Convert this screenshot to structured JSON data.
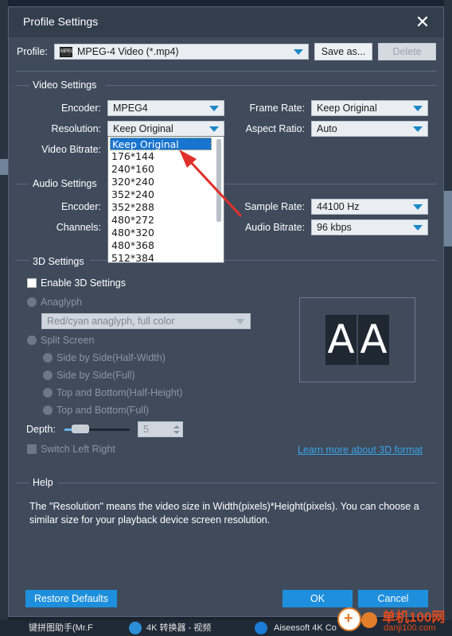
{
  "window": {
    "title": "Profile Settings",
    "close_glyph": "✕"
  },
  "profile": {
    "label": "Profile:",
    "value": "MPEG-4 Video (*.mp4)",
    "icon_text": "MPEG4",
    "save_as_label": "Save as...",
    "delete_label": "Delete"
  },
  "video": {
    "section_title": "Video Settings",
    "encoder_label": "Encoder:",
    "encoder_value": "MPEG4",
    "frame_rate_label": "Frame Rate:",
    "frame_rate_value": "Keep Original",
    "resolution_label": "Resolution:",
    "resolution_value": "Keep Original",
    "aspect_ratio_label": "Aspect Ratio:",
    "aspect_ratio_value": "Auto",
    "bitrate_label": "Video Bitrate:"
  },
  "resolution_dropdown": {
    "options": [
      "Keep Original",
      "176*144",
      "240*160",
      "320*240",
      "352*240",
      "352*288",
      "480*272",
      "480*320",
      "480*368",
      "512*384"
    ],
    "selected_index": 0
  },
  "audio": {
    "section_title": "Audio Settings",
    "encoder_label": "Encoder:",
    "sample_rate_label": "Sample Rate:",
    "sample_rate_value": "44100 Hz",
    "channels_label": "Channels:",
    "audio_bitrate_label": "Audio Bitrate:",
    "audio_bitrate_value": "96 kbps"
  },
  "three_d": {
    "section_title": "3D Settings",
    "enable_label": "Enable 3D Settings",
    "anaglyph_label": "Anaglyph",
    "anaglyph_value": "Red/cyan anaglyph, full color",
    "split_screen_label": "Split Screen",
    "sbs_half_label": "Side by Side(Half-Width)",
    "sbs_full_label": "Side by Side(Full)",
    "tb_half_label": "Top and Bottom(Half-Height)",
    "tb_full_label": "Top and Bottom(Full)",
    "depth_label": "Depth:",
    "depth_value": "5",
    "depth_level": 0.15,
    "switch_label": "Switch Left Right",
    "learn_more_label": "Learn more about 3D format",
    "preview_letter_left": "A",
    "preview_letter_right": "A"
  },
  "help": {
    "section_title": "Help",
    "text": "The \"Resolution\" means the video size in Width(pixels)*Height(pixels).  You can choose a similar size for your playback device screen resolution."
  },
  "footer": {
    "restore_label": "Restore Defaults",
    "ok_label": "OK",
    "cancel_label": "Cancel"
  },
  "taskbar": {
    "item1": "键拼图助手(Mr.F",
    "item2": "4K 转换器 - 视频",
    "item3": "Aiseesoft 4K Co"
  },
  "watermark": {
    "title": "单机100网",
    "url": "danji100.com"
  },
  "colors": {
    "dialog_bg": "#3f4b5b",
    "accent_blue": "#1e8fdc",
    "link_blue": "#3aa3e8",
    "selection_blue": "#1874cf",
    "annotation_red": "#e0302a"
  }
}
